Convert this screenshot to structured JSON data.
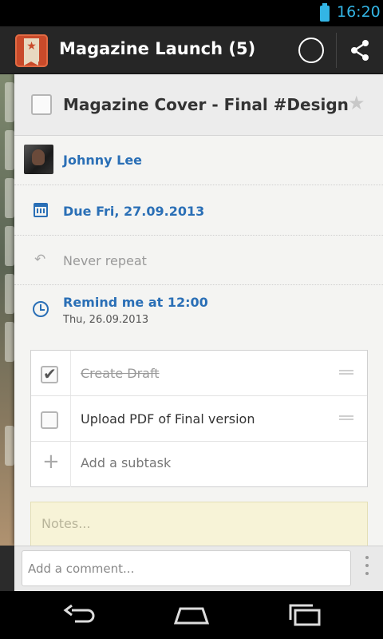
{
  "status_bar": {
    "time": "16:20"
  },
  "action_bar": {
    "title": "Magazine Launch (5)"
  },
  "task": {
    "title": "Magazine Cover - Final #Design",
    "completed": false,
    "starred": false
  },
  "assignee": {
    "name": "Johnny  Lee"
  },
  "due": {
    "label": "Due Fri, 27.09.2013"
  },
  "repeat": {
    "label": "Never repeat"
  },
  "reminder": {
    "label": "Remind me at 12:00",
    "date": "Thu, 26.09.2013"
  },
  "subtasks": [
    {
      "label": "Create Draft",
      "done": true
    },
    {
      "label": "Upload PDF of Final version",
      "done": false
    }
  ],
  "add_subtask": {
    "label": "Add a subtask"
  },
  "notes": {
    "placeholder": "Notes..."
  },
  "comment": {
    "placeholder": "Add a comment..."
  },
  "colors": {
    "accent_blue": "#2a6fb6",
    "status_blue": "#33b5e5",
    "app_red": "#c94a2a"
  }
}
